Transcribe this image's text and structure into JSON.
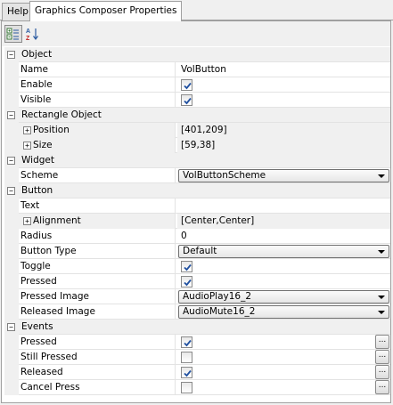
{
  "tabs": [
    {
      "label": "Help",
      "active": false
    },
    {
      "label": "Graphics Composer Properties",
      "active": true
    }
  ],
  "toolbar": {
    "categorized_icon": "categorized-view-icon",
    "alphabetical_icon": "alphabetical-sort-icon"
  },
  "colors": {
    "accent": "#3a6ea5",
    "gutter": "#f0f0f0"
  },
  "rows": [
    {
      "kind": "cat",
      "label": "Object"
    },
    {
      "kind": "text",
      "label": "Name",
      "value": "VolButton"
    },
    {
      "kind": "check",
      "label": "Enable",
      "checked": true
    },
    {
      "kind": "check",
      "label": "Visible",
      "checked": true
    },
    {
      "kind": "cat",
      "label": "Rectangle Object"
    },
    {
      "kind": "sub",
      "label": "Position",
      "value": "[401,209]"
    },
    {
      "kind": "sub",
      "label": "Size",
      "value": "[59,38]"
    },
    {
      "kind": "cat",
      "label": "Widget"
    },
    {
      "kind": "combo",
      "label": "Scheme",
      "value": "VolButtonScheme"
    },
    {
      "kind": "cat",
      "label": "Button"
    },
    {
      "kind": "text",
      "label": "Text",
      "value": ""
    },
    {
      "kind": "sub",
      "label": "Alignment",
      "value": "[Center,Center]"
    },
    {
      "kind": "text",
      "label": "Radius",
      "value": "0"
    },
    {
      "kind": "combo",
      "label": "Button Type",
      "value": "Default"
    },
    {
      "kind": "check",
      "label": "Toggle",
      "checked": true
    },
    {
      "kind": "check",
      "label": "Pressed",
      "checked": true
    },
    {
      "kind": "combo",
      "label": "Pressed Image",
      "value": "AudioPlay16_2"
    },
    {
      "kind": "combo",
      "label": "Released Image",
      "value": "AudioMute16_2"
    },
    {
      "kind": "cat",
      "label": "Events"
    },
    {
      "kind": "event",
      "label": "Pressed",
      "checked": true,
      "button": "..."
    },
    {
      "kind": "event",
      "label": "Still Pressed",
      "checked": false,
      "button": "..."
    },
    {
      "kind": "event",
      "label": "Released",
      "checked": true,
      "button": "..."
    },
    {
      "kind": "event",
      "label": "Cancel Press",
      "checked": false,
      "button": "..."
    }
  ]
}
